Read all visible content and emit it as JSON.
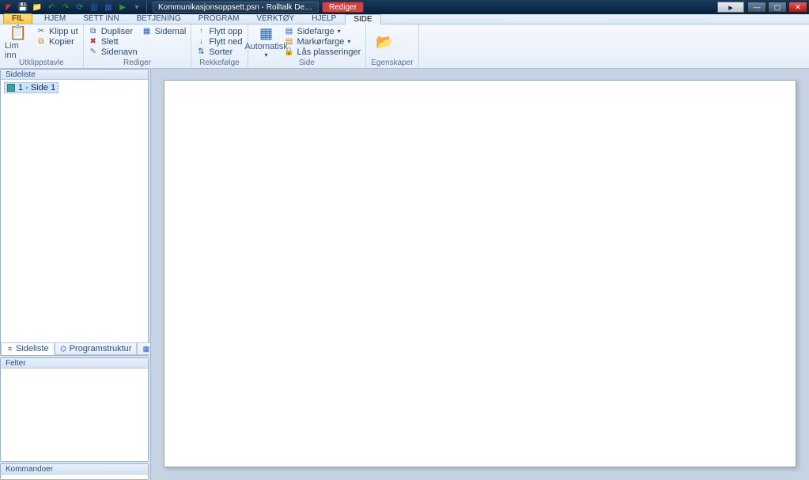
{
  "taskbar": {
    "title": "Kommunikasjonsoppsett.psn - Rolltalk Desig…",
    "chip": "Rediger",
    "ghost_center": "",
    "go_label": "▸"
  },
  "tabs": {
    "file": "FIL",
    "items": [
      "HJEM",
      "SETT INN",
      "BETJENING",
      "PROGRAM",
      "VERKTØY",
      "HJELP",
      "SIDE"
    ],
    "active_index": 6
  },
  "ribbon": {
    "utklippstavle": {
      "label": "Utklippstavle",
      "lim_inn": "Lim inn",
      "klipp_ut": "Klipp ut",
      "kopier": "Kopier"
    },
    "rediger": {
      "label": "Rediger",
      "dupliser": "Dupliser",
      "slett": "Slett",
      "sidenavn": "Sidenavn",
      "sidemal": "Sidemal"
    },
    "rekkefolge": {
      "label": "Rekkefølge",
      "flytt_opp": "Flytt opp",
      "flytt_ned": "Flytt ned",
      "sorter": "Sorter"
    },
    "side": {
      "label": "Side",
      "automatisk": "Automatisk",
      "sidefarge": "Sidefarge",
      "markorfarge": "Markørfarge",
      "las": "Lås plasseringer"
    },
    "egenskaper": {
      "label": "Egenskaper"
    }
  },
  "panels": {
    "sideliste_title": "Sideliste",
    "side_items": [
      "1 - Side 1"
    ],
    "view_tabs": [
      "Sideliste",
      "Programstruktur",
      "Miniatyrsider"
    ],
    "view_active": 0,
    "felter_title": "Felter",
    "kommandoer_title": "Kommandoer"
  }
}
